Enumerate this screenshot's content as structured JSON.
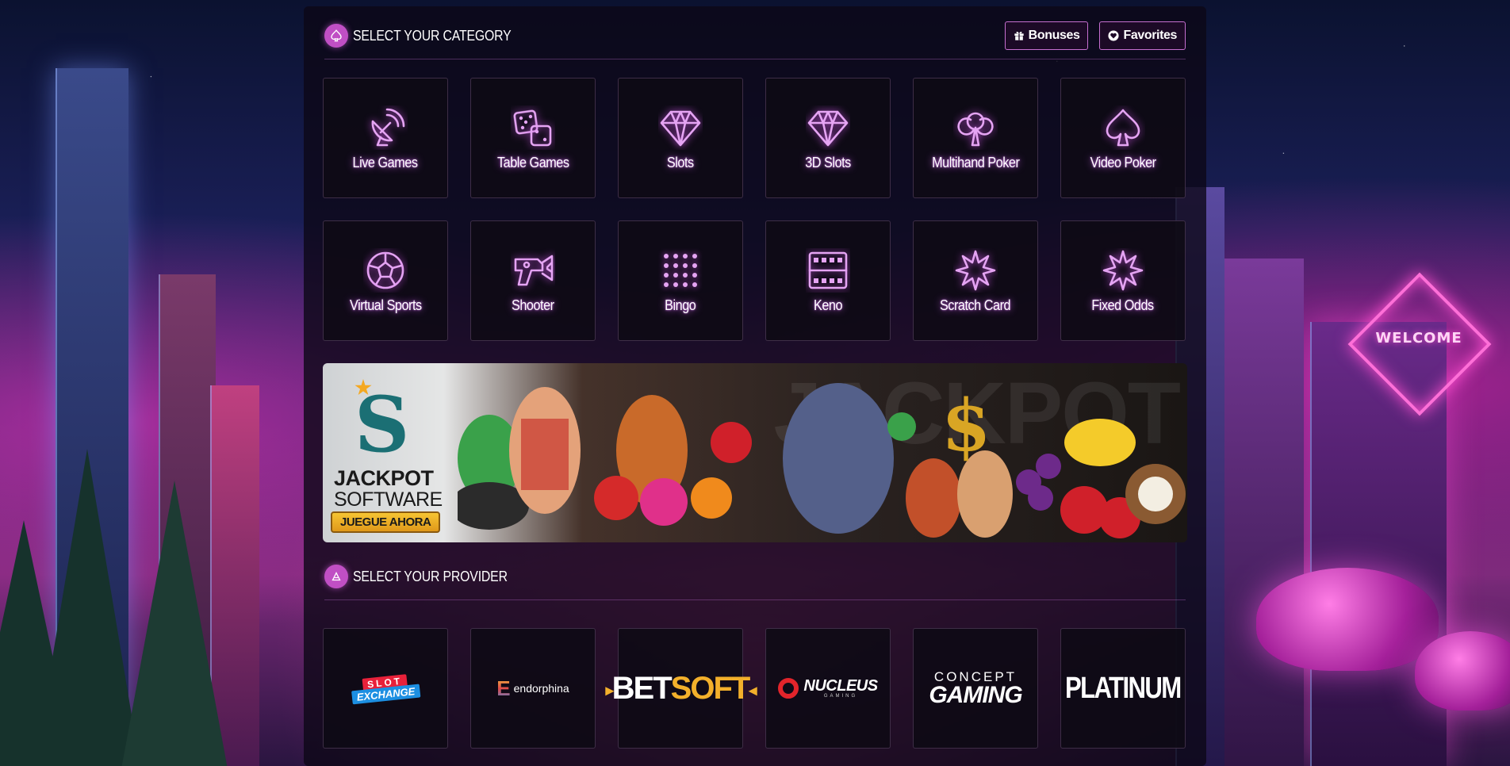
{
  "categories_section": {
    "title": "SELECT YOUR CATEGORY",
    "bonuses_label": "Bonuses",
    "favorites_label": "Favorites"
  },
  "categories": [
    {
      "label": "Live Games",
      "icon": "satellite-dish-icon"
    },
    {
      "label": "Table Games",
      "icon": "dice-icon"
    },
    {
      "label": "Slots",
      "icon": "diamond-icon"
    },
    {
      "label": "3D Slots",
      "icon": "diamond-icon"
    },
    {
      "label": "Multihand Poker",
      "icon": "club-icon"
    },
    {
      "label": "Video Poker",
      "icon": "spade-icon"
    },
    {
      "label": "Virtual Sports",
      "icon": "soccer-ball-icon"
    },
    {
      "label": "Shooter",
      "icon": "blaster-icon"
    },
    {
      "label": "Bingo",
      "icon": "dot-grid-icon"
    },
    {
      "label": "Keno",
      "icon": "keno-grid-icon"
    },
    {
      "label": "Scratch Card",
      "icon": "starburst-icon"
    },
    {
      "label": "Fixed Odds",
      "icon": "starburst-icon"
    }
  ],
  "banner": {
    "brand_title": "JACKPOT",
    "brand_sub": "SOFTWARE",
    "cta": "JUEGUE AHORA",
    "bg_word": "JACKPOT"
  },
  "providers_section": {
    "title": "SELECT YOUR PROVIDER"
  },
  "providers": {
    "slot_exchange": {
      "line1": "SLOT",
      "line2": "EXCHANGE"
    },
    "endorphina": {
      "mark": "E",
      "name": "endorphina"
    },
    "betsoft": {
      "bet": "BET",
      "soft": "SOFT"
    },
    "nucleus": {
      "name": "NUCLEUS",
      "sub": "GAMING"
    },
    "concept": {
      "line1": "CONCEPT",
      "line2": "GAMING"
    },
    "platinum": {
      "name": "PLATINUM"
    }
  },
  "scenery": {
    "welcome_sign": "WELCOME"
  },
  "colors": {
    "accent": "#c04fc4",
    "glyph": "#e5a4f3",
    "button_border": "#c66fd0"
  }
}
